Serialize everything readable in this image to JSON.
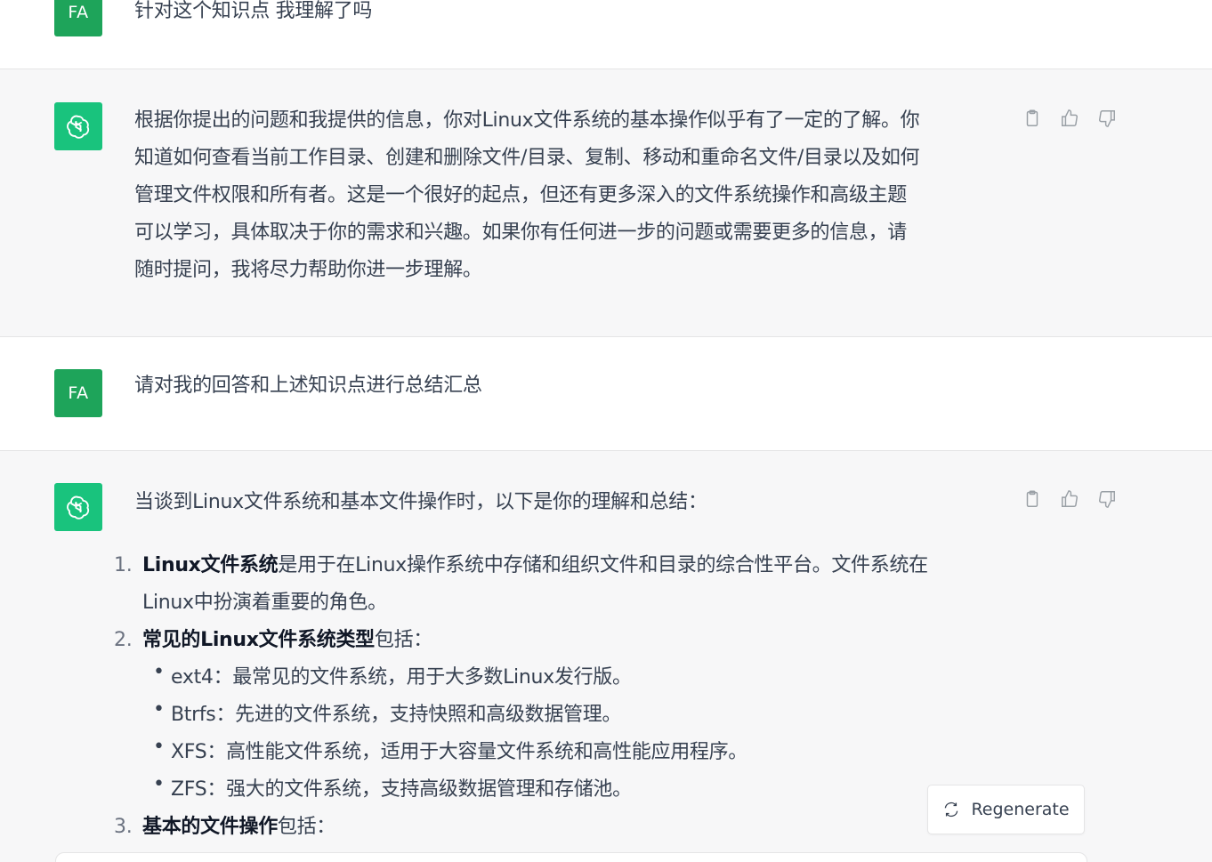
{
  "messages": [
    {
      "role": "user",
      "avatar": "FA",
      "text": "针对这个知识点 我理解了吗"
    },
    {
      "role": "assistant",
      "avatar_icon": "openai-logo-icon",
      "lines": [
        "根据你提出的问题和我提供的信息，你对Linux文件系统的基本操作似乎有了一定的了解。你",
        "知道如何查看当前工作目录、创建和删除文件/目录、复制、移动和重命名文件/目录以及如何",
        "管理文件权限和所有者。这是一个很好的起点，但还有更多深入的文件系统操作和高级主题",
        "可以学习，具体取决于你的需求和兴趣。如果你有任何进一步的问题或需要更多的信息，请",
        "随时提问，我将尽力帮助你进一步理解。"
      ]
    },
    {
      "role": "user",
      "avatar": "FA",
      "text": "请对我的回答和上述知识点进行总结汇总"
    },
    {
      "role": "assistant",
      "avatar_icon": "openai-logo-icon",
      "intro": "当谈到Linux文件系统和基本文件操作时，以下是你的理解和总结：",
      "items": [
        {
          "num": "1.",
          "bold": "Linux文件系统",
          "rest_line1": "是用于在Linux操作系统中存储和组织文件和目录的综合性平台。文件系统在",
          "rest_line2": "Linux中扮演着重要的角色。"
        },
        {
          "num": "2.",
          "bold": "常见的Linux文件系统类型",
          "rest": "包括：",
          "sub": [
            "ext4：最常见的文件系统，用于大多数Linux发行版。",
            "Btrfs：先进的文件系统，支持快照和高级数据管理。",
            "XFS：高性能文件系统，适用于大容量文件系统和高性能应用程序。",
            "ZFS：强大的文件系统，支持高级数据管理和存储池。"
          ]
        },
        {
          "num": "3.",
          "bold": "基本的文件操作",
          "rest": "包括："
        }
      ]
    }
  ],
  "actions": {
    "copy_icon": "clipboard-icon",
    "like_icon": "thumbs-up-icon",
    "dislike_icon": "thumbs-down-icon"
  },
  "regenerate": {
    "label": "Regenerate",
    "icon": "refresh-icon"
  },
  "colors": {
    "user_avatar": "#1ea45a",
    "bot_avatar": "#19c37d",
    "bot_bg": "#f7f7f8"
  }
}
